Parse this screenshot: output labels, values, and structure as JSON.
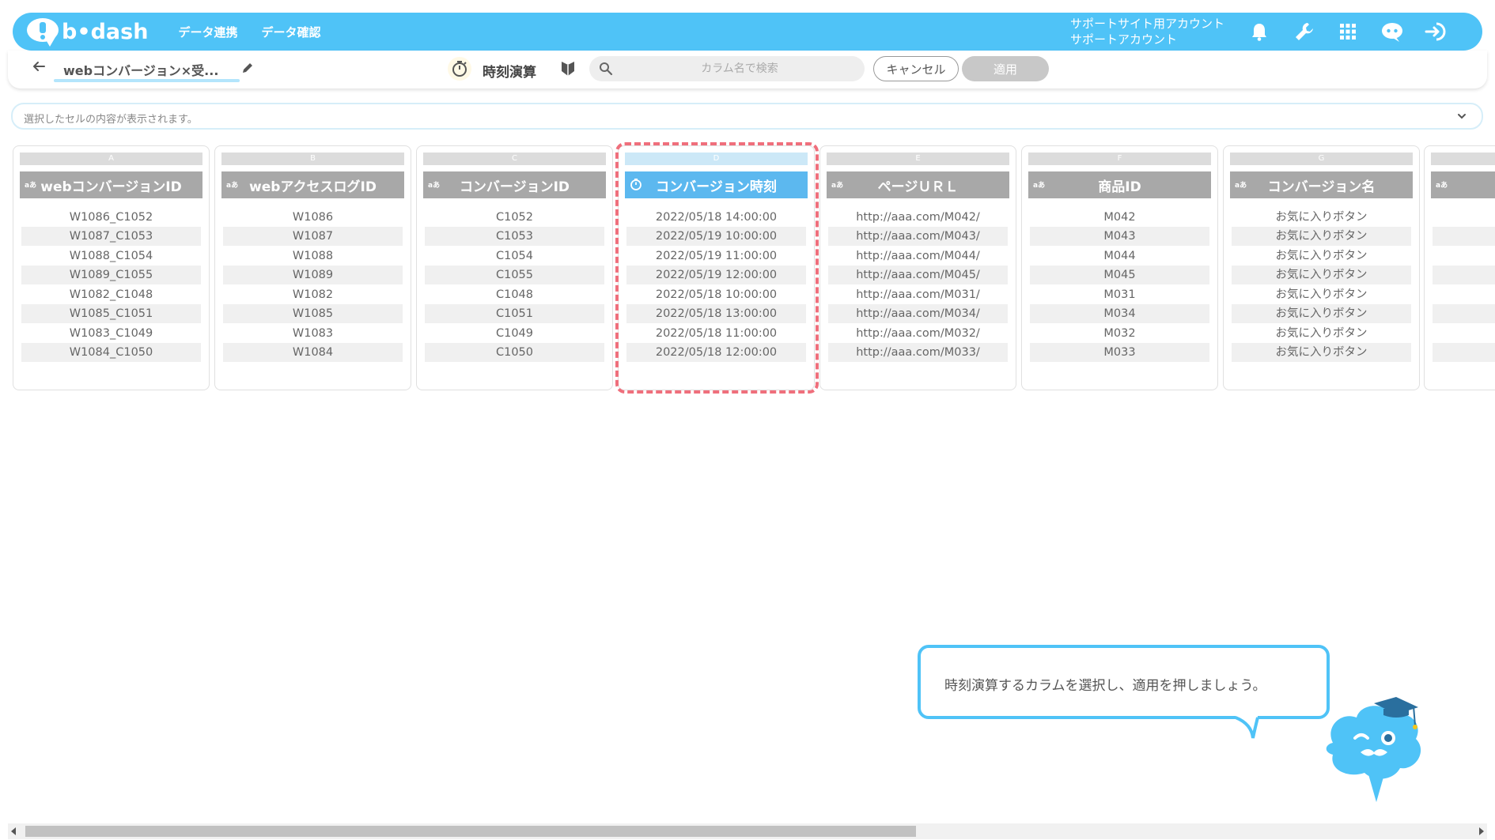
{
  "app": {
    "logo_text": "b•dash",
    "nav": [
      "データ連携",
      "データ確認"
    ],
    "account_line1": "サポートサイト用アカウント",
    "account_line2": "サポートアカウント",
    "accent_color": "#4fc3f7"
  },
  "toolbar": {
    "page_title": "webコンバージョン×受...",
    "mode_title": "時刻演算",
    "search_placeholder": "カラム名で検索",
    "cancel_label": "キャンセル",
    "apply_label": "適用"
  },
  "cell_bar": {
    "placeholder": "選択したセルの内容が表示されます。"
  },
  "type_badge": "aあ",
  "columns": [
    {
      "letter": "A",
      "header": "webコンバージョンID",
      "cells": [
        "W1086_C1052",
        "W1087_C1053",
        "W1088_C1054",
        "W1089_C1055",
        "W1082_C1048",
        "W1085_C1051",
        "W1083_C1049",
        "W1084_C1050"
      ]
    },
    {
      "letter": "B",
      "header": "webアクセスログID",
      "cells": [
        "W1086",
        "W1087",
        "W1088",
        "W1089",
        "W1082",
        "W1085",
        "W1083",
        "W1084"
      ]
    },
    {
      "letter": "C",
      "header": "コンバージョンID",
      "cells": [
        "C1052",
        "C1053",
        "C1054",
        "C1055",
        "C1048",
        "C1051",
        "C1049",
        "C1050"
      ]
    },
    {
      "letter": "D",
      "header": "コンバージョン時刻",
      "cells": [
        "2022/05/18 14:00:00",
        "2022/05/19 10:00:00",
        "2022/05/19 11:00:00",
        "2022/05/19 12:00:00",
        "2022/05/18 10:00:00",
        "2022/05/18 13:00:00",
        "2022/05/18 11:00:00",
        "2022/05/18 12:00:00"
      ]
    },
    {
      "letter": "E",
      "header": "ページＵＲＬ",
      "cells": [
        "http://aaa.com/M042/",
        "http://aaa.com/M043/",
        "http://aaa.com/M044/",
        "http://aaa.com/M045/",
        "http://aaa.com/M031/",
        "http://aaa.com/M034/",
        "http://aaa.com/M032/",
        "http://aaa.com/M033/"
      ]
    },
    {
      "letter": "F",
      "header": "商品ID",
      "cells": [
        "M042",
        "M043",
        "M044",
        "M045",
        "M031",
        "M034",
        "M032",
        "M033"
      ]
    },
    {
      "letter": "G",
      "header": "コンバージョン名",
      "cells": [
        "お気に入りボタン",
        "お気に入りボタン",
        "お気に入りボタン",
        "お気に入りボタン",
        "お気に入りボタン",
        "お気に入りボタン",
        "お気に入りボタン",
        "お気に入りボタン"
      ]
    }
  ],
  "tooltip": {
    "text": "時刻演算するカラムを選択し、適用を押しましょう。"
  }
}
